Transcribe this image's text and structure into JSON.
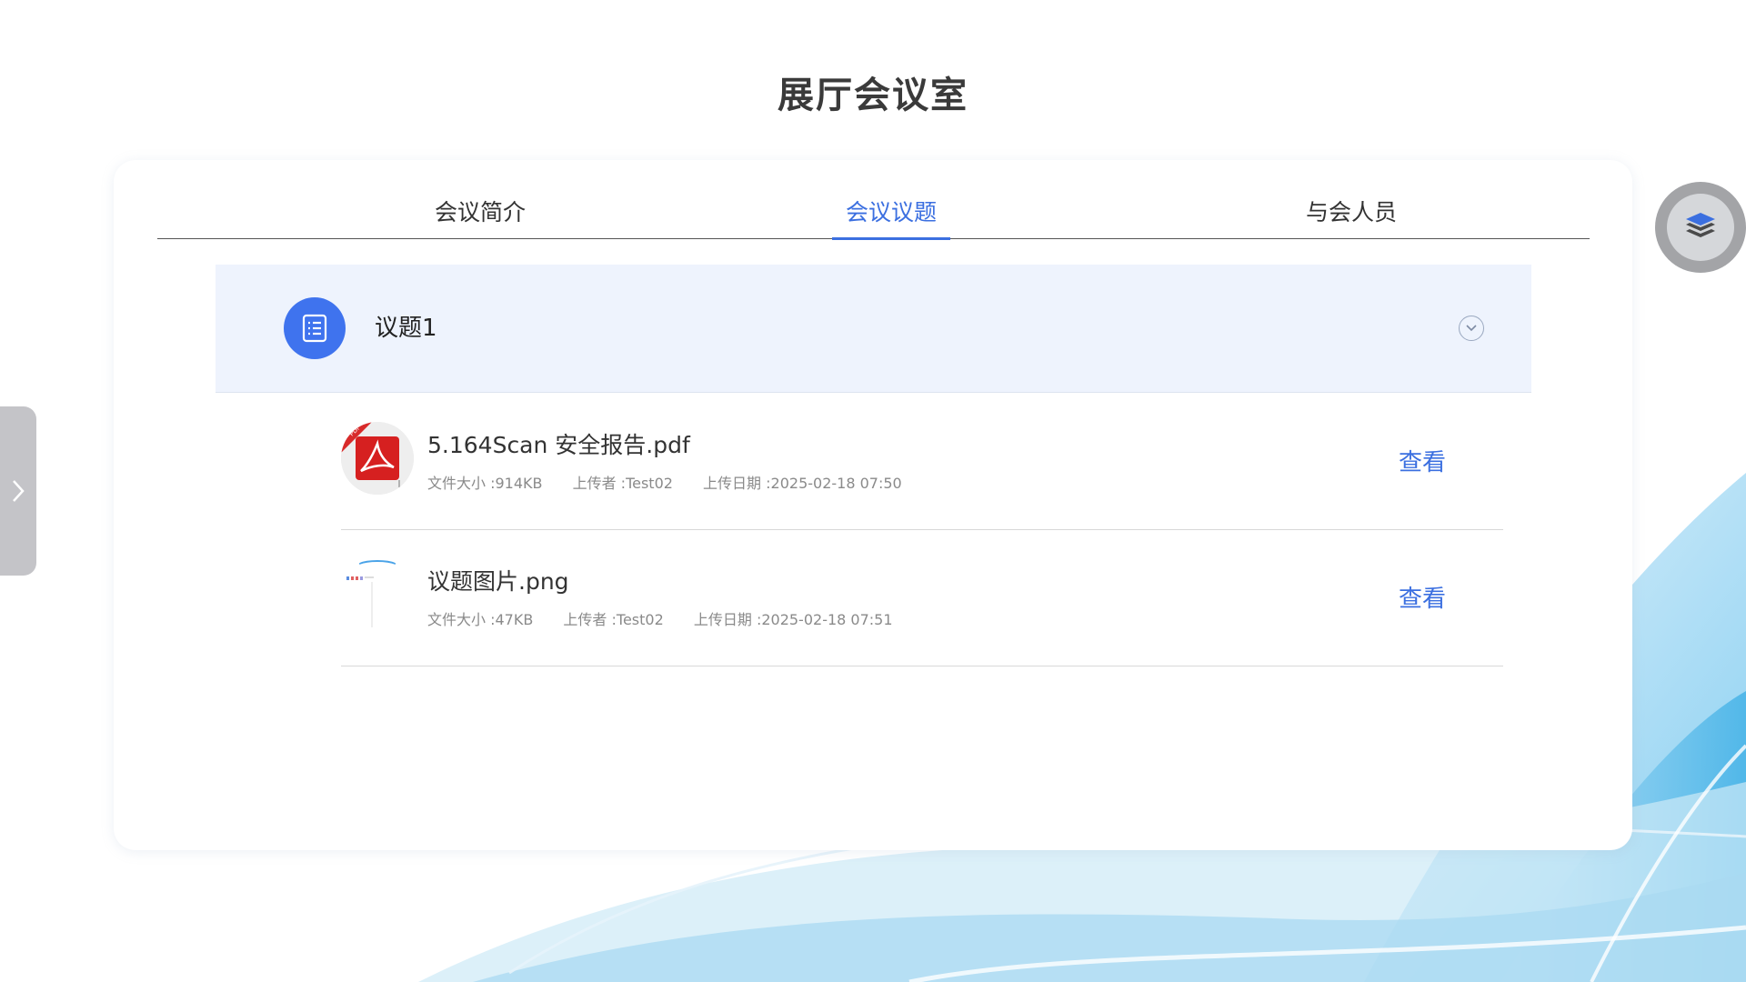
{
  "page": {
    "title": "展厅会议室"
  },
  "tabs": [
    {
      "label": "会议简介",
      "active": false
    },
    {
      "label": "会议议题",
      "active": true
    },
    {
      "label": "与会人员",
      "active": false
    }
  ],
  "agenda": {
    "title": "议题1",
    "icon": "document-list-icon",
    "expanded": true,
    "files": [
      {
        "name": "5.164Scan 安全报告.pdf",
        "size": "文件大小 :914KB",
        "uploader": "上传者 :Test02",
        "date": "上传日期 :2025-02-18 07:50",
        "icon": "pdf-file-icon",
        "action": "查看"
      },
      {
        "name": "议题图片.png",
        "size": "文件大小 :47KB",
        "uploader": "上传者 :Test02",
        "date": "上传日期 :2025-02-18 07:51",
        "icon": "image-thumbnail",
        "action": "查看"
      }
    ]
  },
  "colors": {
    "accent": "#3b6fe0",
    "agenda_header_bg": "#eef3fd",
    "agenda_icon_bg": "#3f73ee"
  },
  "controls": {
    "side_handle_icon": "chevron-right-icon",
    "floating_button_icon": "layers-icon"
  }
}
